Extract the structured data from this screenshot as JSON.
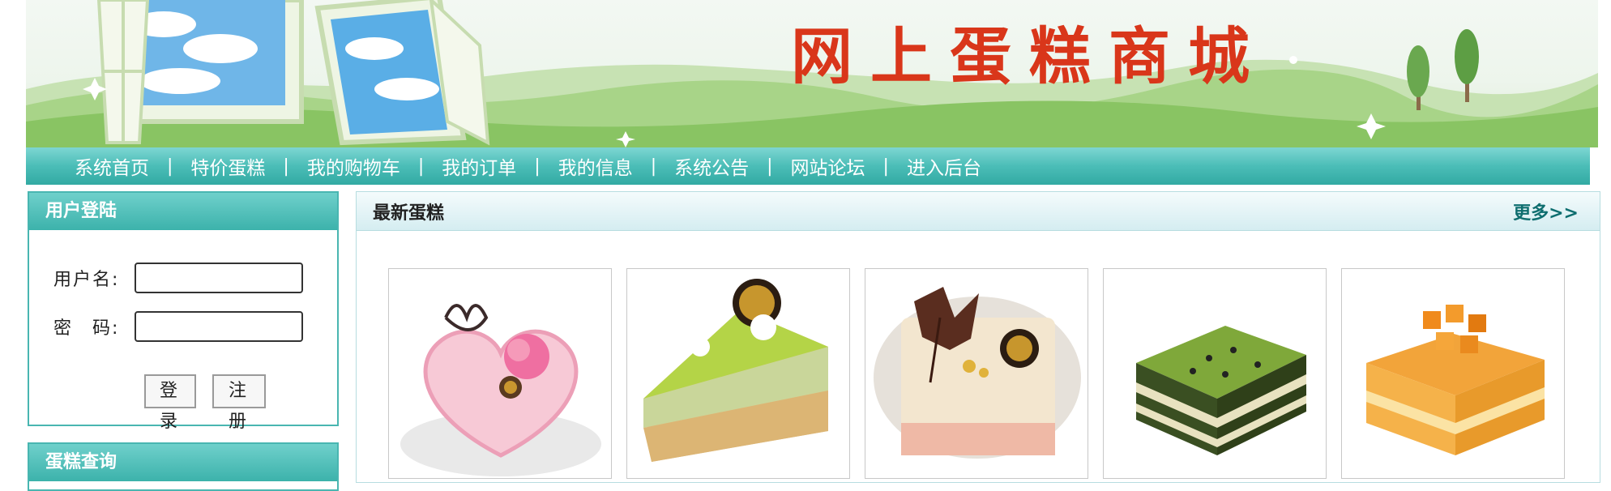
{
  "banner": {
    "title": "网上蛋糕商城"
  },
  "nav": {
    "items": [
      "系统首页",
      "特价蛋糕",
      "我的购物车",
      "我的订单",
      "我的信息",
      "系统公告",
      "网站论坛",
      "进入后台"
    ],
    "separator": "|"
  },
  "login": {
    "title": "用户登陆",
    "username_label": "用户名:",
    "password_label": "密　码:",
    "username_value": "",
    "password_value": "",
    "login_button": "登录",
    "register_button": "注册"
  },
  "search": {
    "title": "蛋糕查询"
  },
  "latest": {
    "title": "最新蛋糕",
    "more": "更多>>",
    "cakes": [
      {
        "image": "heart-strawberry-cake-image"
      },
      {
        "image": "matcha-slice-cake-image"
      },
      {
        "image": "chocolate-leaf-cake-image"
      },
      {
        "image": "green-tea-square-cake-image"
      },
      {
        "image": "mango-cube-cake-image"
      }
    ]
  },
  "colors": {
    "nav": "#4bbdb7",
    "title": "#d9361a",
    "more": "#0e6e6f"
  }
}
